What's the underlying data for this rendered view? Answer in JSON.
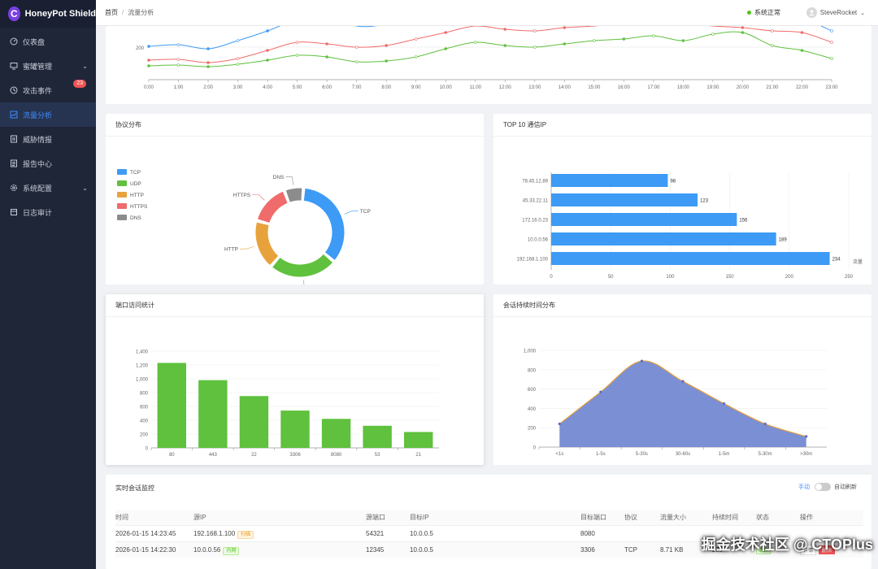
{
  "app": {
    "title": "HoneyPot Shield",
    "logo_letter": "C"
  },
  "sidebar": {
    "items": [
      {
        "label": "仪表盘",
        "icon": "dashboard-icon"
      },
      {
        "label": "蜜罐管理",
        "icon": "monitor-icon",
        "has_arrow": true
      },
      {
        "label": "攻击事件",
        "icon": "clock-icon",
        "badge": "23"
      },
      {
        "label": "流量分析",
        "icon": "chart-icon",
        "active": true
      },
      {
        "label": "威胁情报",
        "icon": "doc-icon"
      },
      {
        "label": "报告中心",
        "icon": "report-icon"
      },
      {
        "label": "系统配置",
        "icon": "gear-icon",
        "has_arrow": true
      },
      {
        "label": "日志审计",
        "icon": "log-icon"
      }
    ]
  },
  "topbar": {
    "breadcrumb_home": "首页",
    "breadcrumb_sep": "/",
    "breadcrumb_current": "流量分析",
    "status": "系统正常",
    "user": "SteveRocket"
  },
  "traffic_chart": {
    "hours": [
      "0:00",
      "1:00",
      "2:00",
      "3:00",
      "4:00",
      "5:00",
      "6:00",
      "7:00",
      "8:00",
      "9:00",
      "10:00",
      "11:00",
      "12:00",
      "13:00",
      "14:00",
      "15:00",
      "16:00",
      "17:00",
      "18:00",
      "19:00",
      "20:00",
      "21:00",
      "22:00",
      "23:00"
    ],
    "y_tick": "200"
  },
  "protocol_card": {
    "title": "协议分布",
    "legend": [
      "TCP",
      "UDP",
      "HTTP",
      "HTTPS",
      "DNS"
    ],
    "labels": [
      "TCP",
      "UDP",
      "HTTP",
      "HTTPS",
      "DNS"
    ]
  },
  "top_ip_card": {
    "title": "TOP 10 通信IP",
    "axis_label": "流量"
  },
  "port_card": {
    "title": "端口访问统计"
  },
  "duration_card": {
    "title": "会话持续时间分布"
  },
  "session_card": {
    "title": "实时会话监控",
    "manual": "手动",
    "auto_refresh": "自动刷新",
    "columns": [
      "时间",
      "源IP",
      "源端口",
      "目标IP",
      "目标端口",
      "协议",
      "流量大小",
      "持续时间",
      "状态",
      "操作"
    ],
    "rows": [
      {
        "time": "2026-01-15 14:23:45",
        "src_ip": "192.168.1.100",
        "tag": "扫描",
        "src_port": "54321",
        "dst_ip": "10.0.0.5",
        "dst_port": "8080",
        "proto": "",
        "size": "",
        "dur": "",
        "status": "",
        "detail": "",
        "del": ""
      },
      {
        "time": "2026-01-15 14:22:30",
        "src_ip": "10.0.0.56",
        "tag": "内网",
        "src_port": "12345",
        "dst_ip": "10.0.0.5",
        "dst_port": "3306",
        "proto": "TCP",
        "size": "8.71 KB",
        "dur": "23s",
        "status": "活跃",
        "detail": "详情",
        "del": "删除"
      }
    ]
  },
  "watermark": "掘金技术社区 @ CTOPlus",
  "colors": {
    "tcp": "#3d9bf5",
    "udp": "#5fc13d",
    "http": "#e8a23c",
    "https": "#f06b6b",
    "dns": "#8c8c8c",
    "bar_blue": "#3d9bf5",
    "bar_green": "#5fc13d",
    "area": "#7b8fd4"
  },
  "chart_data": [
    {
      "type": "line",
      "x": [
        "0:00",
        "1:00",
        "2:00",
        "3:00",
        "4:00",
        "5:00",
        "6:00",
        "7:00",
        "8:00",
        "9:00",
        "10:00",
        "11:00",
        "12:00",
        "13:00",
        "14:00",
        "15:00",
        "16:00",
        "17:00",
        "18:00",
        "19:00",
        "20:00",
        "21:00",
        "22:00",
        "23:00"
      ],
      "series": [
        {
          "color": "#3d9bf5",
          "values": [
            205,
            215,
            190,
            240,
            300,
            370,
            400,
            330,
            340,
            380,
            420,
            480,
            500,
            510,
            530,
            520,
            520,
            560,
            510,
            480,
            460,
            420,
            380,
            300
          ]
        },
        {
          "color": "#f06b6b",
          "values": [
            120,
            125,
            105,
            130,
            180,
            230,
            220,
            200,
            210,
            250,
            290,
            330,
            310,
            300,
            320,
            330,
            350,
            390,
            350,
            330,
            320,
            300,
            290,
            230
          ]
        },
        {
          "color": "#5fc13d",
          "values": [
            85,
            90,
            80,
            95,
            120,
            150,
            140,
            110,
            115,
            140,
            190,
            230,
            210,
            200,
            220,
            240,
            250,
            270,
            240,
            280,
            290,
            210,
            180,
            130
          ]
        }
      ],
      "ylim": [
        0,
        300
      ]
    },
    {
      "type": "pie",
      "labels": [
        "TCP",
        "UDP",
        "HTTP",
        "HTTPS",
        "DNS"
      ],
      "values": [
        35,
        25,
        18,
        15,
        7
      ]
    },
    {
      "type": "bar",
      "orientation": "horizontal",
      "categories": [
        "78.45.12.89",
        "45.33.22.11",
        "172.16.0.23",
        "10.0.0.56",
        "192.168.1.100"
      ],
      "values": [
        98,
        123,
        156,
        189,
        234
      ],
      "xlim": [
        0,
        250
      ],
      "xticks": [
        "0",
        "50",
        "100",
        "150",
        "200",
        "250"
      ]
    },
    {
      "type": "bar",
      "categories": [
        "80",
        "443",
        "22",
        "3306",
        "8080",
        "53",
        "21"
      ],
      "values": [
        1230,
        980,
        750,
        540,
        420,
        320,
        230
      ],
      "ylim": [
        0,
        1400
      ],
      "yticks": [
        "0",
        "200",
        "400",
        "600",
        "800",
        "1,000",
        "1,200",
        "1,400"
      ]
    },
    {
      "type": "area",
      "categories": [
        "<1s",
        "1-5s",
        "5-30s",
        "30-60s",
        "1-5m",
        "5-30m",
        ">30m"
      ],
      "values": [
        240,
        570,
        890,
        680,
        450,
        240,
        110
      ],
      "ylim": [
        0,
        1000
      ],
      "yticks": [
        "0",
        "200",
        "400",
        "600",
        "800",
        "1,000"
      ]
    }
  ]
}
